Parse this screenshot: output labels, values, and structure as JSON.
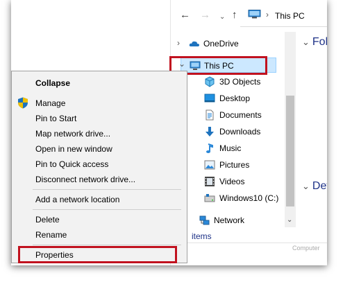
{
  "toolbar": {
    "back_glyph": "←",
    "forward_glyph": "→",
    "recent_glyph": "⌄",
    "up_glyph": "↑",
    "address_separator": "›",
    "address": "This PC"
  },
  "nav": {
    "items": [
      {
        "label": "OneDrive",
        "icon": "cloud-icon"
      },
      {
        "label": "This PC",
        "icon": "computer-icon"
      },
      {
        "label": "3D Objects",
        "icon": "cube-icon"
      },
      {
        "label": "Desktop",
        "icon": "desktop-icon"
      },
      {
        "label": "Documents",
        "icon": "document-icon"
      },
      {
        "label": "Downloads",
        "icon": "download-arrow-icon"
      },
      {
        "label": "Music",
        "icon": "music-note-icon"
      },
      {
        "label": "Pictures",
        "icon": "picture-icon"
      },
      {
        "label": "Videos",
        "icon": "film-icon"
      },
      {
        "label": "Windows10 (C:)",
        "icon": "drive-icon"
      },
      {
        "label": "Network",
        "icon": "network-icon"
      }
    ],
    "chevron_collapsed": "›",
    "chevron_expanded": "⌄"
  },
  "right_pane": {
    "group_1": "Folde",
    "group_2": "Devic",
    "chevron": "⌄"
  },
  "status": {
    "items": "items",
    "watermark": "Computer"
  },
  "context_menu": {
    "items": [
      "Collapse",
      "Manage",
      "Pin to Start",
      "Map network drive...",
      "Open in new window",
      "Pin to Quick access",
      "Disconnect network drive...",
      "Add a network location",
      "Delete",
      "Rename",
      "Properties"
    ]
  },
  "colors": {
    "highlight_border": "#c1121f",
    "selection_fill": "#cce8ff",
    "group_header": "#1e3287"
  }
}
